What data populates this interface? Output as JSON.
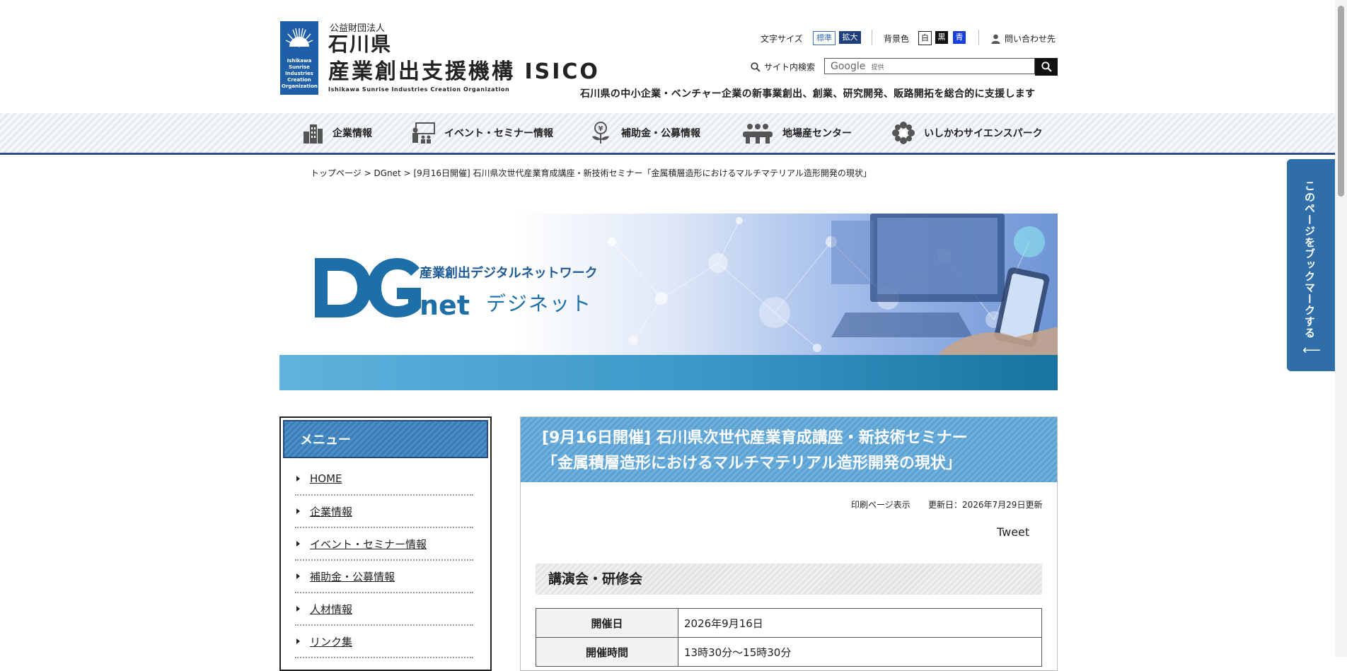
{
  "header": {
    "org_type": "公益財団法人",
    "org_name_line1": "石川県",
    "org_name_line2": "産業創出支援機構 ISICO",
    "org_name_en": "Ishikawa Sunrise Industries Creation Organization",
    "emblem_text": "Ishikawa Sunrise Industries Creation Organization",
    "tagline": "石川県の中小企業・ベンチャー企業の新事業創出、創業、研究開発、販路開拓を総合的に支援します",
    "font_size_label": "文字サイズ",
    "font_size_standard": "標準",
    "font_size_large": "拡大",
    "bg_color_label": "背景色",
    "bg_white": "白",
    "bg_black": "黒",
    "bg_blue": "青",
    "contact": "問い合わせ先",
    "search_label": "サイト内検索",
    "search_placeholder_brand": "Google",
    "search_placeholder_provided": "提供"
  },
  "nav": {
    "items": [
      {
        "label": "企業情報",
        "icon": "building-icon"
      },
      {
        "label": "イベント・セミナー情報",
        "icon": "seminar-icon"
      },
      {
        "label": "補助金・公募情報",
        "icon": "subsidy-icon"
      },
      {
        "label": "地場産センター",
        "icon": "local-industry-icon"
      },
      {
        "label": "いしかわサイエンスパーク",
        "icon": "science-park-icon"
      }
    ]
  },
  "breadcrumb": {
    "home": "トップページ",
    "sep1": ">",
    "section": "DGnet",
    "sep2": ">",
    "current": "[9月16日開催] 石川県次世代産業育成講座・新技術セミナー「金属積層造形におけるマルチマテリアル造形開発の現状」"
  },
  "banner": {
    "logo_dg": "DG",
    "logo_net": "net",
    "subtitle": "産業創出デジタルネットワーク",
    "kana": "デジネット"
  },
  "sidebar": {
    "title": "メニュー",
    "items": [
      {
        "label": "HOME"
      },
      {
        "label": "企業情報"
      },
      {
        "label": "イベント・セミナー情報"
      },
      {
        "label": "補助金・公募情報"
      },
      {
        "label": "人材情報"
      },
      {
        "label": "リンク集"
      }
    ]
  },
  "article": {
    "title_line1": "[9月16日開催] 石川県次世代産業育成講座・新技術セミナー",
    "title_line2": "「金属積層造形におけるマルチマテリアル造形開発の現状」",
    "print_link": "印刷ページ表示",
    "updated": "更新日：2026年7月29日更新",
    "tweet": "Tweet",
    "section_heading": "講演会・研修会",
    "table": [
      {
        "label": "開催日",
        "value": "2026年9月16日"
      },
      {
        "label": "開催時間",
        "value": "13時30分～15時30分"
      }
    ]
  },
  "bookmark": {
    "label": "このページをブックマークする",
    "arrow": "⟵"
  },
  "colors": {
    "nav_border": "#2f4f86",
    "article_header": "#5aa0d1",
    "bookmark_tab": "#2f6ea8",
    "emblem": "#1f5fa8"
  }
}
